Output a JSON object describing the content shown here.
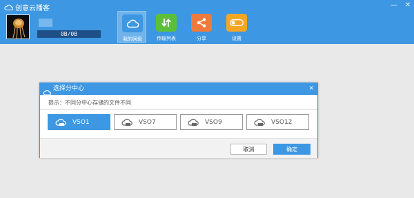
{
  "app": {
    "title": "创意云播客",
    "brand_color": "#3d97e2"
  },
  "window_controls": {
    "minimize": "—",
    "close": "✕"
  },
  "user": {
    "quota_text": "0B/0B"
  },
  "nav": [
    {
      "label": "我的网盘",
      "icon": "cloud-icon",
      "color": "#3d97e2",
      "active": true
    },
    {
      "label": "传输列表",
      "icon": "transfer-icon",
      "color": "#5cbf3c"
    },
    {
      "label": "分享",
      "icon": "share-icon",
      "color": "#f07a3c"
    },
    {
      "label": "设置",
      "icon": "settings-toggle-icon",
      "color": "#f5a623"
    }
  ],
  "dialog": {
    "title": "选择分中心",
    "close": "✕",
    "hint": "提示：不同分中心存储的文件不同",
    "options": [
      {
        "label": "VSO1",
        "selected": true
      },
      {
        "label": "VSO7"
      },
      {
        "label": "VSO9"
      },
      {
        "label": "VSO12"
      }
    ],
    "cancel_label": "取消",
    "ok_label": "确定"
  }
}
